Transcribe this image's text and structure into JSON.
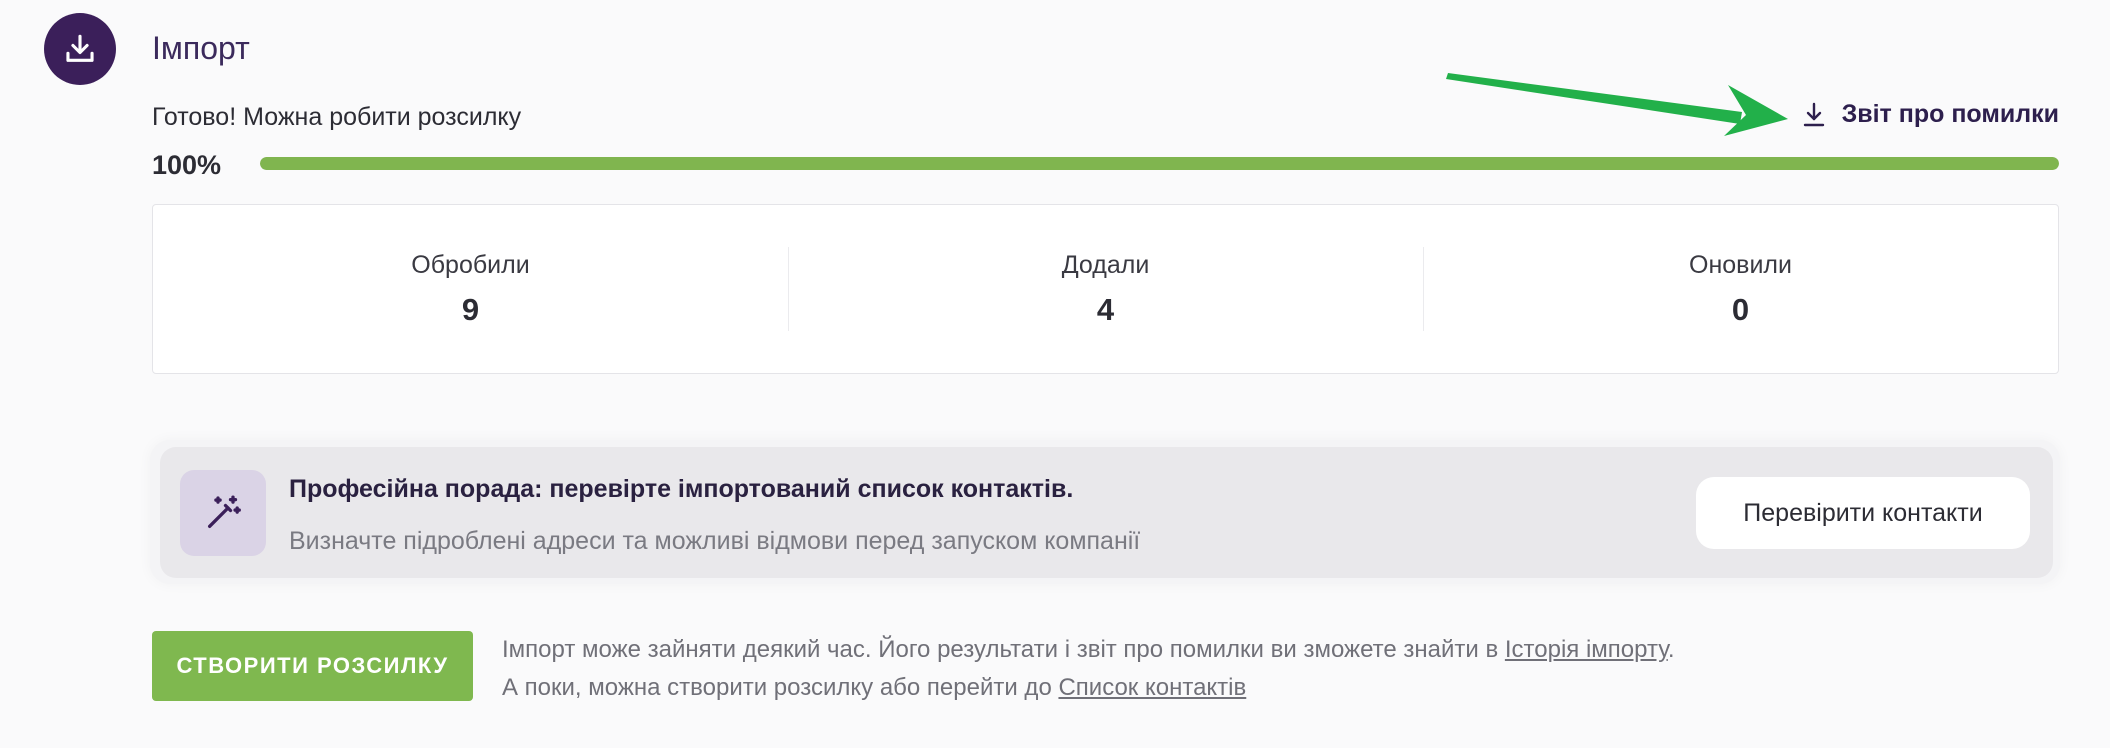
{
  "header": {
    "title": "Імпорт",
    "icon": "download-icon",
    "icon_bg": "#3b1f5a"
  },
  "status": {
    "message": "Готово! Можна робити розсилку",
    "report_link_label": "Звіт про помилки",
    "report_icon": "download-icon",
    "progress_label": "100%",
    "progress_fraction": 1.0,
    "progress_color": "#80b54f"
  },
  "stats": [
    {
      "label": "Обробили",
      "value": "9"
    },
    {
      "label": "Додали",
      "value": "4"
    },
    {
      "label": "Оновили",
      "value": "0"
    }
  ],
  "tip": {
    "icon": "magic-wand-icon",
    "title": "Професійна порада: перевірте імпортований список контактів.",
    "description": "Визначте підроблені адреси та можливі відмови перед запуском компанії",
    "button_label": "Перевірити контакти"
  },
  "actions": {
    "create_button_label": "СТВОРИТИ РОЗСИЛКУ",
    "create_button_color": "#7fb84f"
  },
  "note": {
    "line1_text": "Імпорт може зайняти деякий час. Його результати і звіт про помилки ви зможете знайти в ",
    "line1_link": "Історія імпорту",
    "line1_end": ".",
    "line2_text": "А поки, можна створити розсилку або перейти до ",
    "line2_link": "Список контактів"
  },
  "annotation": {
    "arrow_color": "#22b04a"
  }
}
